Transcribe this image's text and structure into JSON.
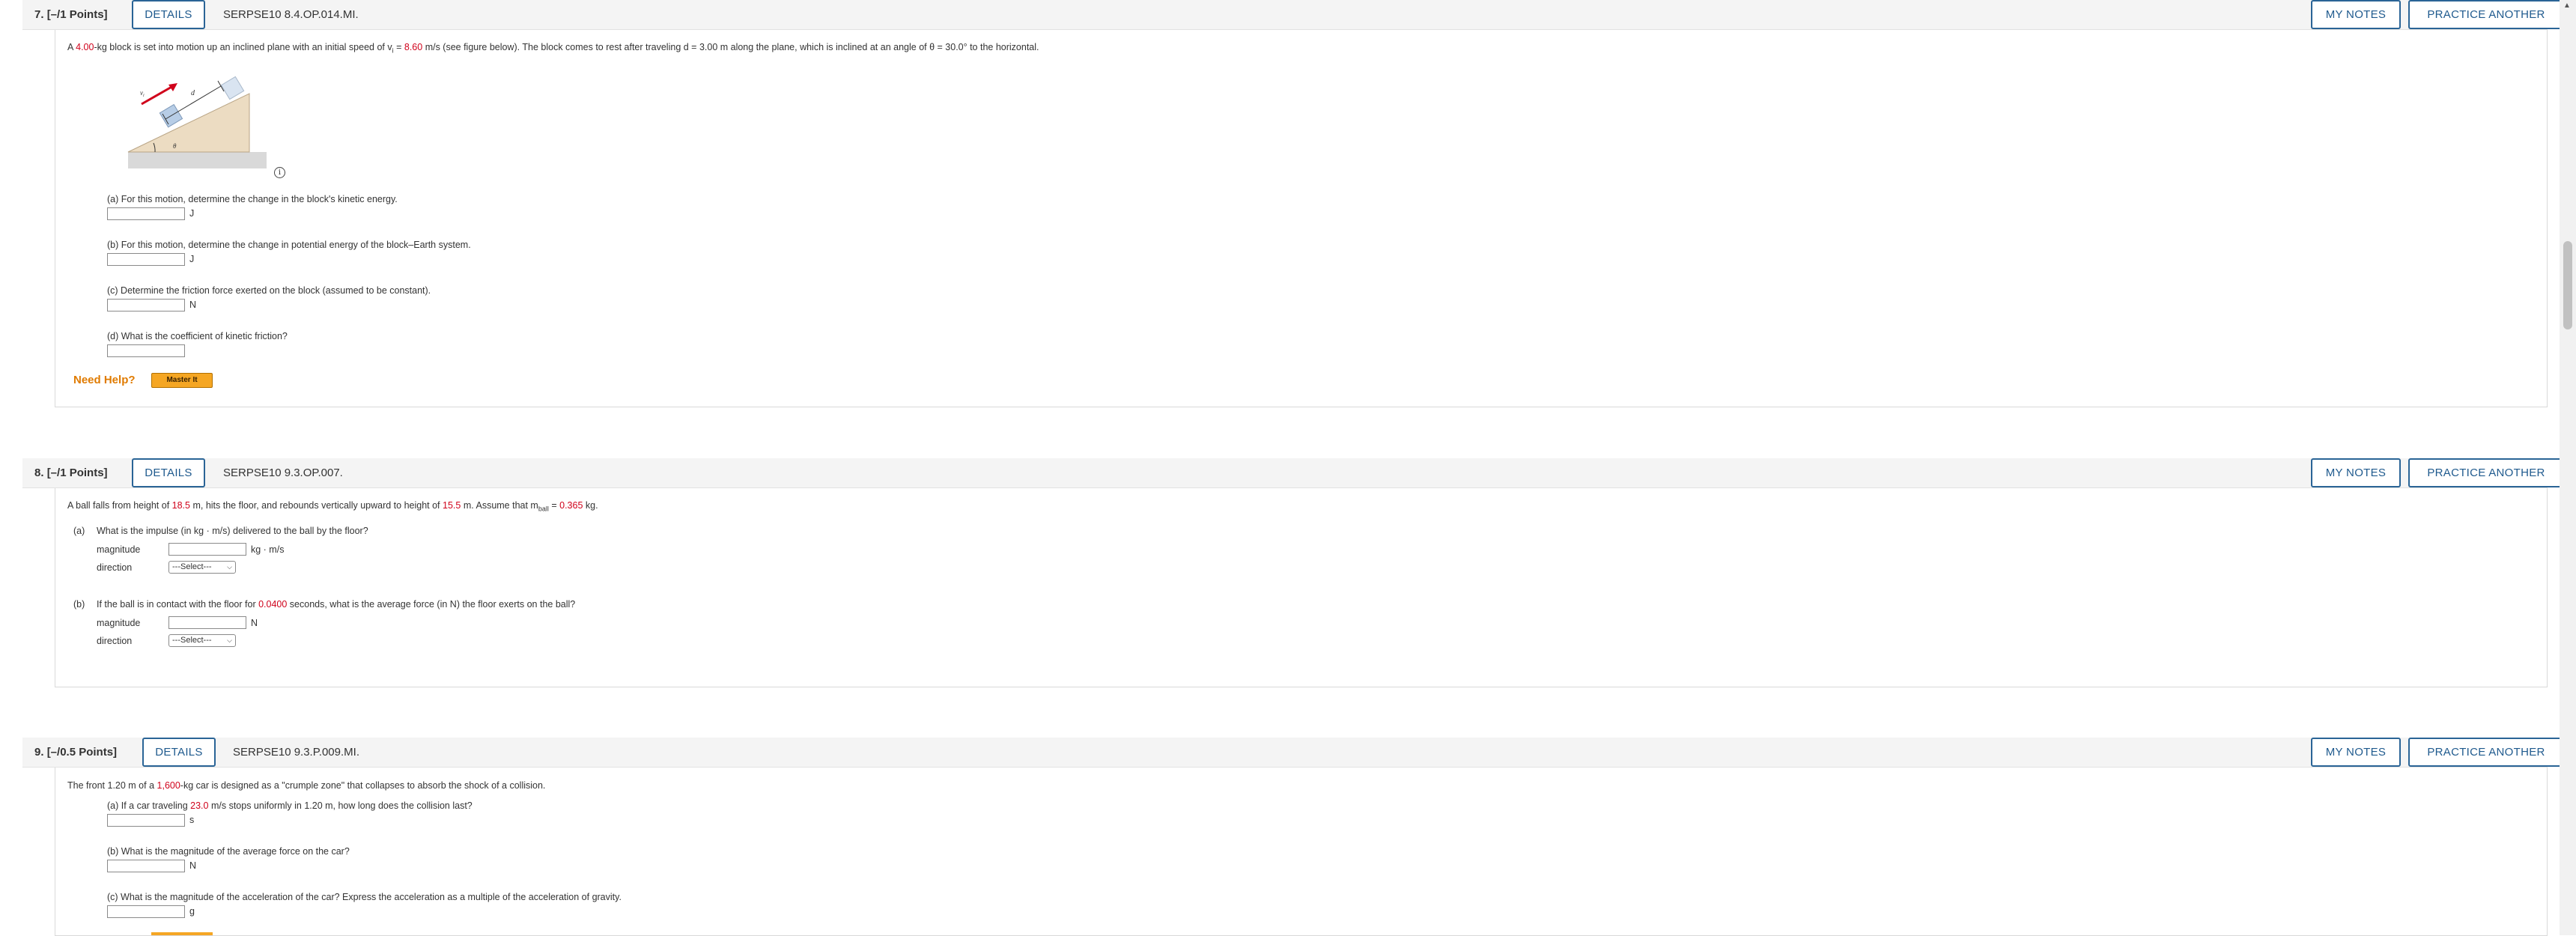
{
  "common": {
    "details_label": "DETAILS",
    "my_notes_label": "MY NOTES",
    "practice_label": "PRACTICE ANOTHER",
    "select_placeholder": "---Select---"
  },
  "q7": {
    "number": "7.",
    "points": "[–/1 Points]",
    "code": "SERPSE10 8.4.OP.014.MI.",
    "stem": {
      "t1": "A ",
      "mass": "4.00",
      "t2": "-kg block is set into motion up an inclined plane with an initial speed of v",
      "sub_i": "i",
      "t3": " = ",
      "speed": "8.60",
      "t4": " m/s (see figure below). The block comes to rest after traveling d = 3.00 m along the plane, which is inclined at an angle of θ = 30.0° to the horizontal."
    },
    "figure": {
      "label_vi": "v",
      "label_vi_sub": "i",
      "label_d": "d",
      "label_theta": "θ",
      "info": "i"
    },
    "parts": [
      {
        "prompt": "(a) For this motion, determine the change in the block's kinetic energy.",
        "unit": "J"
      },
      {
        "prompt": "(b) For this motion, determine the change in potential energy of the block–Earth system.",
        "unit": "J"
      },
      {
        "prompt": "(c) Determine the friction force exerted on the block (assumed to be constant).",
        "unit": "N"
      },
      {
        "prompt": "(d) What is the coefficient of kinetic friction?",
        "unit": ""
      }
    ],
    "need_help": "Need Help?",
    "master_it": "Master It"
  },
  "q8": {
    "number": "8.",
    "points": "[–/1 Points]",
    "code": "SERPSE10 9.3.OP.007.",
    "stem": {
      "t1": "A ball falls from height of ",
      "h1": "18.5",
      "t2": " m, hits the floor, and rebounds vertically upward to height of ",
      "h2": "15.5",
      "t3": " m. Assume that m",
      "sub": "ball",
      "t4": " = ",
      "m": "0.365",
      "t5": " kg."
    },
    "part_a": {
      "label": "(a)",
      "prompt": "What is the impulse (in kg · m/s) delivered to the ball by the floor?",
      "magnitude_label": "magnitude",
      "magnitude_unit": "kg · m/s",
      "direction_label": "direction"
    },
    "part_b": {
      "label": "(b)",
      "t1": "If the ball is in contact with the floor for ",
      "time": "0.0400",
      "t2": " seconds, what is the average force (in N) the floor exerts on the ball?",
      "magnitude_label": "magnitude",
      "magnitude_unit": "N",
      "direction_label": "direction"
    }
  },
  "q9": {
    "number": "9.",
    "points": "[–/0.5 Points]",
    "code": "SERPSE10 9.3.P.009.MI.",
    "stem": {
      "t1": "The front 1.20 m of a ",
      "mass": "1,600",
      "t2": "-kg car is designed as a \"crumple zone\" that collapses to absorb the shock of a collision."
    },
    "part_a": {
      "t1": "(a) If a car traveling ",
      "speed": "23.0",
      "t2": " m/s stops uniformly in 1.20 m, how long does the collision last?",
      "unit": "s"
    },
    "part_b": {
      "prompt": "(b) What is the magnitude of the average force on the car?",
      "unit": "N"
    },
    "part_c": {
      "prompt": "(c) What is the magnitude of the acceleration of the car? Express the acceleration as a multiple of the acceleration of gravity.",
      "unit": "g"
    }
  }
}
